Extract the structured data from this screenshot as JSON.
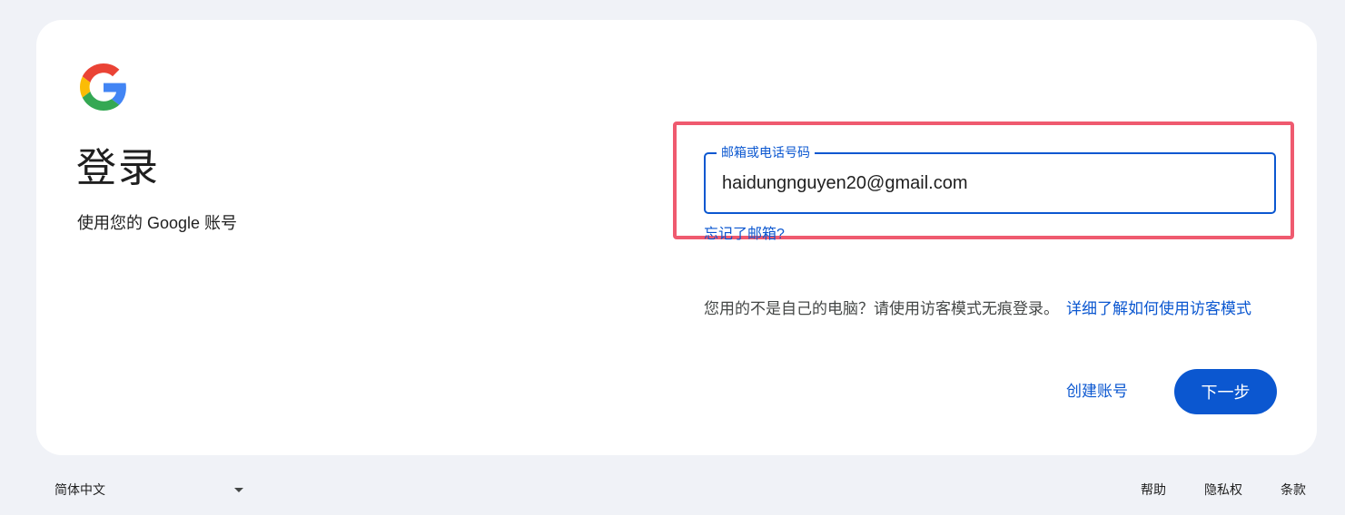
{
  "card": {
    "title": "登录",
    "subtitle": "使用您的 Google 账号"
  },
  "logo": {
    "icon": "google-g-icon",
    "colors": {
      "blue": "#4285F4",
      "red": "#EA4335",
      "yellow": "#FBBC05",
      "green": "#34A853"
    }
  },
  "email_field": {
    "label": "邮箱或电话号码",
    "value": "haidungnguyen20@gmail.com"
  },
  "forgot_email": "忘记了邮箱?",
  "guest_note": {
    "text": "您用的不是自己的电脑？请使用访客模式无痕登录。",
    "link": "详细了解如何使用访客模式"
  },
  "actions": {
    "create_account": "创建账号",
    "next": "下一步"
  },
  "footer": {
    "language": "简体中文",
    "links": [
      "帮助",
      "隐私权",
      "条款"
    ]
  },
  "colors": {
    "accent": "#0b57d0",
    "highlight": "#ef5a6f",
    "background": "#f0f2f7"
  }
}
